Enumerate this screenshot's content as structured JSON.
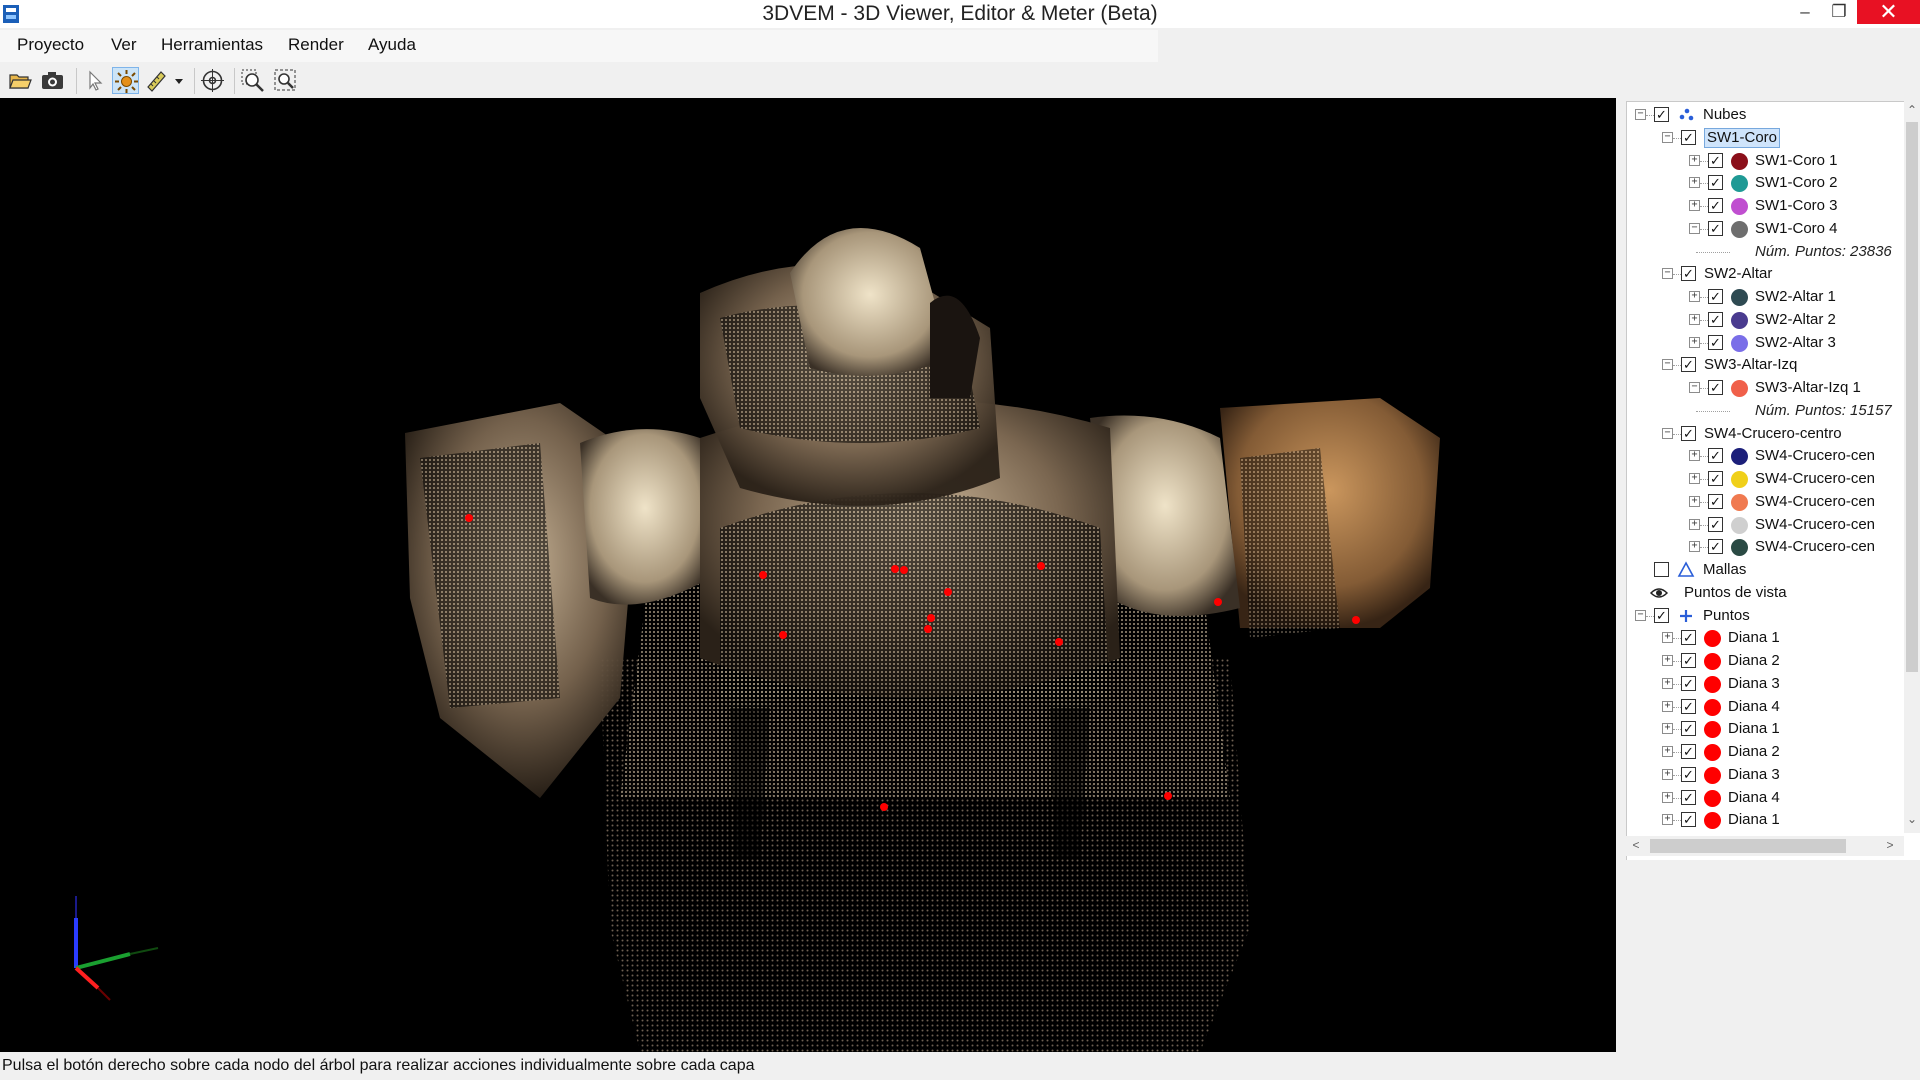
{
  "window": {
    "title": "3DVEM - 3D Viewer, Editor & Meter (Beta)",
    "minimize_glyph": "–",
    "maximize_glyph": "❐",
    "close_glyph": "✕"
  },
  "menu": {
    "items": [
      "Proyecto",
      "Ver",
      "Herramientas",
      "Render",
      "Ayuda"
    ]
  },
  "toolbar": {
    "icons": [
      "open-folder-icon",
      "camera-icon",
      "select-cursor-icon",
      "sun-light-icon",
      "measure-ruler-icon",
      "dropdown-arrow-icon",
      "target-orbit-icon",
      "zoom-in-icon",
      "zoom-extents-icon"
    ],
    "active_tool": "sun-light-icon"
  },
  "colors": {
    "viewport_bg": "#000000",
    "selection_bg": "#cfe4fb",
    "target_dot": "#ff0000"
  },
  "tree": {
    "nodes": [
      {
        "label": "Nubes",
        "level": 0,
        "expander": "⊟",
        "checked": true,
        "icon": "point-cloud-icon"
      },
      {
        "label": "SW1-Coro",
        "level": 1,
        "expander": "⊟",
        "checked": true,
        "selected": true
      },
      {
        "label": "SW1-Coro 1",
        "level": 2,
        "expander": "⊞",
        "checked": true,
        "color": "#8b0f1a"
      },
      {
        "label": "SW1-Coro 2",
        "level": 2,
        "expander": "⊞",
        "checked": true,
        "color": "#1f9a95"
      },
      {
        "label": "SW1-Coro 3",
        "level": 2,
        "expander": "⊞",
        "checked": true,
        "color": "#c04fd0"
      },
      {
        "label": "SW1-Coro 4",
        "level": 2,
        "expander": "⊟",
        "checked": true,
        "color": "#6e6e6e"
      },
      {
        "label": "Núm. Puntos: 23836",
        "level": 3,
        "info": true
      },
      {
        "label": "SW2-Altar",
        "level": 1,
        "expander": "⊟",
        "checked": true
      },
      {
        "label": "SW2-Altar 1",
        "level": 2,
        "expander": "⊞",
        "checked": true,
        "color": "#2e4a52"
      },
      {
        "label": "SW2-Altar 2",
        "level": 2,
        "expander": "⊞",
        "checked": true,
        "color": "#4a3b8f"
      },
      {
        "label": "SW2-Altar 3",
        "level": 2,
        "expander": "⊞",
        "checked": true,
        "color": "#7a6ee8"
      },
      {
        "label": "SW3-Altar-Izq",
        "level": 1,
        "expander": "⊟",
        "checked": true
      },
      {
        "label": "SW3-Altar-Izq 1",
        "level": 2,
        "expander": "⊟",
        "checked": true,
        "color": "#f0604a"
      },
      {
        "label": "Núm. Puntos: 15157",
        "level": 3,
        "info": true
      },
      {
        "label": "SW4-Crucero-centro",
        "level": 1,
        "expander": "⊟",
        "checked": true
      },
      {
        "label": "SW4-Crucero-cen",
        "level": 2,
        "expander": "⊞",
        "checked": true,
        "color": "#1c1f7a"
      },
      {
        "label": "SW4-Crucero-cen",
        "level": 2,
        "expander": "⊞",
        "checked": true,
        "color": "#f0d01a"
      },
      {
        "label": "SW4-Crucero-cen",
        "level": 2,
        "expander": "⊞",
        "checked": true,
        "color": "#f07a50"
      },
      {
        "label": "SW4-Crucero-cen",
        "level": 2,
        "expander": "⊞",
        "checked": true,
        "color": "#cfcfcf"
      },
      {
        "label": "SW4-Crucero-cen",
        "level": 2,
        "expander": "⊞",
        "checked": true,
        "color": "#2a4a44"
      },
      {
        "label": "Mallas",
        "level": 0,
        "checked": false,
        "icon": "mesh-triangle-icon"
      },
      {
        "label": "Puntos de vista",
        "level": 0,
        "icon": "eye-icon"
      },
      {
        "label": "Puntos",
        "level": 0,
        "expander": "⊟",
        "checked": true,
        "icon": "crosshair-plus-icon"
      },
      {
        "label": "Diana 1",
        "level": 1,
        "expander": "⊞",
        "checked": true,
        "color": "#ff0000"
      },
      {
        "label": "Diana 2",
        "level": 1,
        "expander": "⊞",
        "checked": true,
        "color": "#ff0000"
      },
      {
        "label": "Diana 3",
        "level": 1,
        "expander": "⊞",
        "checked": true,
        "color": "#ff0000"
      },
      {
        "label": "Diana 4",
        "level": 1,
        "expander": "⊞",
        "checked": true,
        "color": "#ff0000"
      },
      {
        "label": "Diana 1",
        "level": 1,
        "expander": "⊞",
        "checked": true,
        "color": "#ff0000"
      },
      {
        "label": "Diana 2",
        "level": 1,
        "expander": "⊞",
        "checked": true,
        "color": "#ff0000"
      },
      {
        "label": "Diana 3",
        "level": 1,
        "expander": "⊞",
        "checked": true,
        "color": "#ff0000"
      },
      {
        "label": "Diana 4",
        "level": 1,
        "expander": "⊞",
        "checked": true,
        "color": "#ff0000"
      },
      {
        "label": "Diana 1",
        "level": 1,
        "expander": "⊞",
        "checked": true,
        "color": "#ff0000"
      }
    ]
  },
  "scroll": {
    "up": "⌃",
    "down": "⌄",
    "left": "<",
    "right": ">"
  },
  "status": {
    "text": "Pulsa el botón derecho sobre cada nodo del árbol para realizar acciones individualmente sobre cada capa"
  }
}
